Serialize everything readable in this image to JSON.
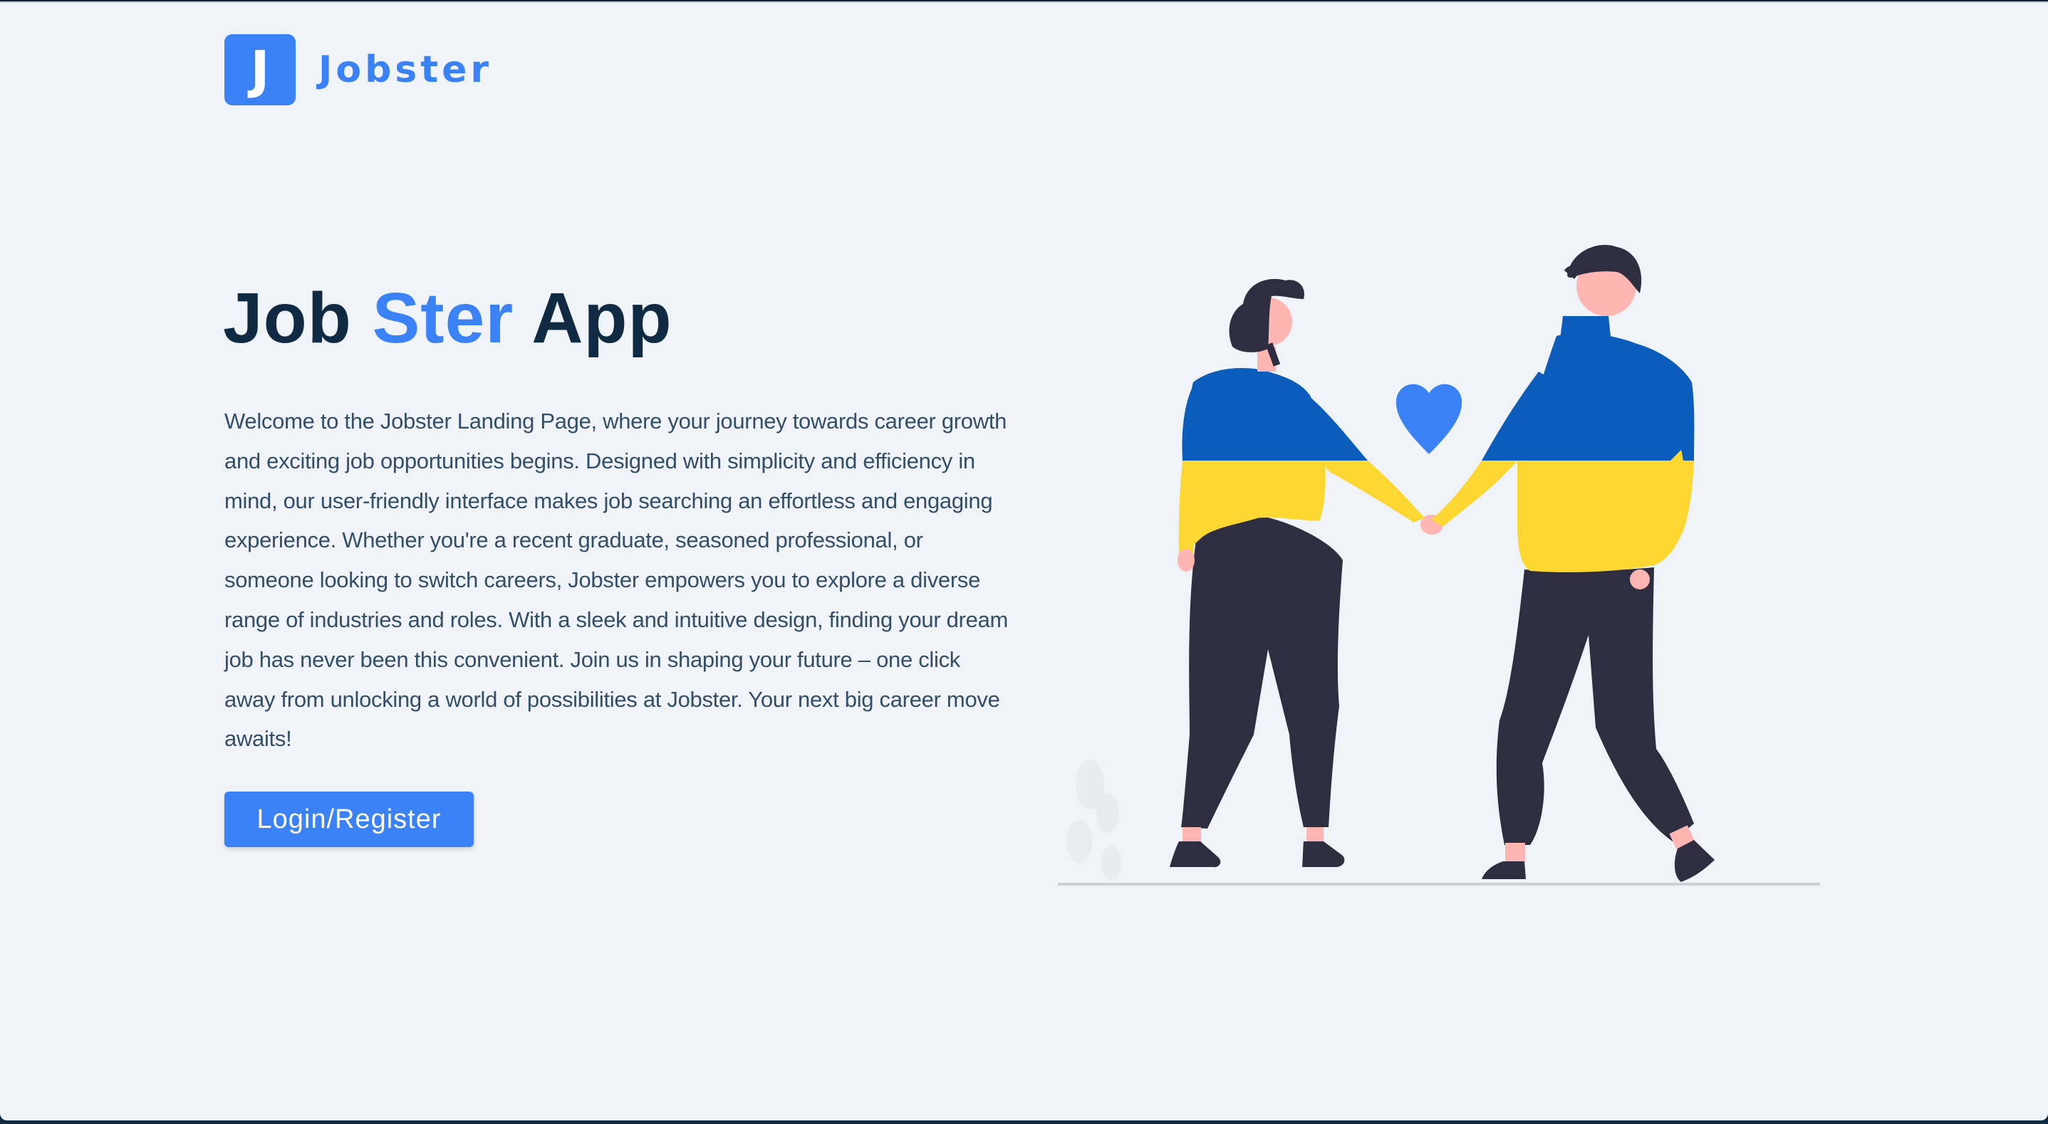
{
  "nav": {
    "logo_letter": "J",
    "brand": "Jobster"
  },
  "hero": {
    "title_part1": "Job",
    "title_accent": "Ster",
    "title_part2": "App",
    "description": "Welcome to the Jobster Landing Page, where your journey towards career growth and exciting job opportunities begins. Designed with simplicity and efficiency in mind, our user-friendly interface makes job searching an effortless and engaging experience. Whether you're a recent graduate, seasoned professional, or someone looking to switch careers, Jobster empowers you to explore a diverse range of industries and roles. With a sleek and intuitive design, finding your dream job has never been this convenient. Join us in shaping your future – one click away from unlocking a world of possibilities at Jobster. Your next big career move awaits!",
    "cta_label": "Login/Register"
  },
  "colors": {
    "primary": "#3b82f6",
    "heading": "#102a43",
    "body_text": "#334e68",
    "background": "#f0f4f8",
    "sweater_blue": "#0b5cbb",
    "sweater_yellow": "#fcd732",
    "pants": "#2f2e41",
    "skin": "#ffb6b3"
  },
  "illustration": {
    "icon": "couple-holding-hands-illustration",
    "heart_icon": "heart-icon"
  }
}
